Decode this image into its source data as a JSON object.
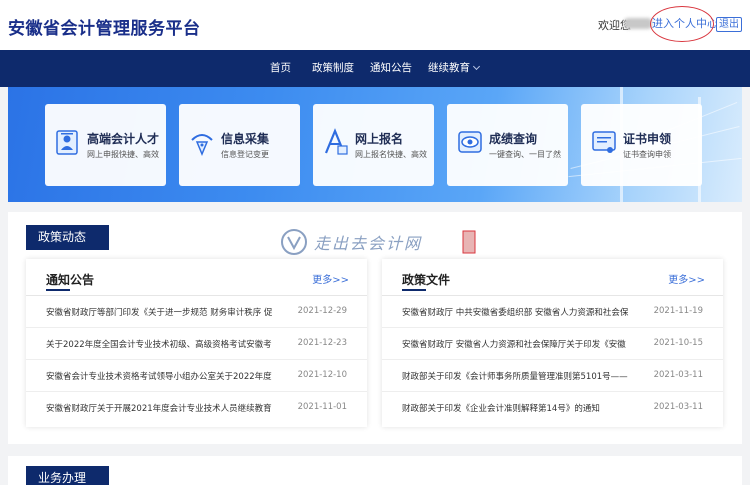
{
  "header": {
    "site_title": "安徽省会计管理服务平台",
    "welcome": "欢迎您",
    "personal_center": "进入个人中心",
    "logout": "退出"
  },
  "nav": {
    "items": [
      {
        "label": "首页"
      },
      {
        "label": "政策制度"
      },
      {
        "label": "通知公告"
      },
      {
        "label": "继续教育"
      }
    ]
  },
  "features": [
    {
      "title": "高端会计人才",
      "subtitle": "网上申报快捷、高效",
      "icon": "talent-icon"
    },
    {
      "title": "信息采集",
      "subtitle": "信息登记变更",
      "icon": "pen-icon"
    },
    {
      "title": "网上报名",
      "subtitle": "网上报名快捷、高效",
      "icon": "register-icon"
    },
    {
      "title": "成绩查询",
      "subtitle": "一键查询、一目了然",
      "icon": "eye-icon"
    },
    {
      "title": "证书申领",
      "subtitle": "证书查询申领",
      "icon": "certificate-icon"
    }
  ],
  "policy_section": {
    "tag": "政策动态",
    "watermark": "走出去会计网"
  },
  "notices": {
    "title": "通知公告",
    "more": "更多>>",
    "rows": [
      {
        "title": "安徽省财政厅等部门印发《关于进一步规范 财务审计秩序 促",
        "date": "2021-12-29"
      },
      {
        "title": "关于2022年度全国会计专业技术初级、高级资格考试安徽考",
        "date": "2021-12-23"
      },
      {
        "title": "安徽省会计专业技术资格考试领导小组办公室关于2022年度",
        "date": "2021-12-10"
      },
      {
        "title": "安徽省财政厅关于开展2021年度会计专业技术人员继续教育",
        "date": "2021-11-01"
      }
    ]
  },
  "policies": {
    "title": "政策文件",
    "more": "更多>>",
    "rows": [
      {
        "title": "安徽省财政厅 中共安徽省委组织部 安徽省人力资源和社会保",
        "date": "2021-11-19"
      },
      {
        "title": "安徽省财政厅 安徽省人力资源和社会保障厅关于印发《安徽",
        "date": "2021-10-15"
      },
      {
        "title": "财政部关于印发《会计师事务所质量管理准则第5101号——",
        "date": "2021-03-11"
      },
      {
        "title": "财政部关于印发《企业会计准则解释第14号》的通知",
        "date": "2021-03-11"
      }
    ]
  },
  "business_section": {
    "tag": "业务办理"
  },
  "colors": {
    "brand_navy": "#0e2a6c",
    "title_blue": "#1a2f8a",
    "link_blue": "#3b6fd8",
    "highlight_red": "#d9363e"
  }
}
